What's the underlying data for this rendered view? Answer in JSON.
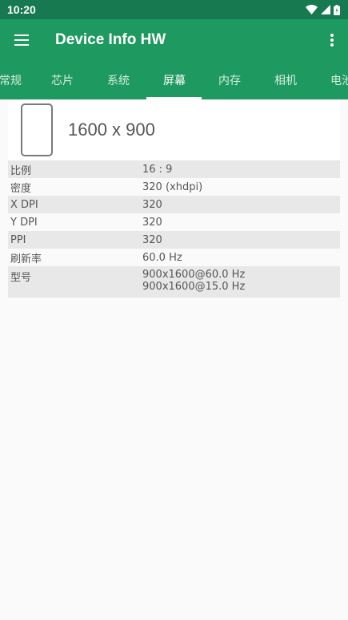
{
  "status_bar": {
    "time": "10:20",
    "icons": [
      "wifi-icon",
      "signal-icon",
      "battery-icon"
    ]
  },
  "app_bar": {
    "title": "Device Info HW",
    "menu_icon": "hamburger-menu-icon",
    "overflow_icon": "more-vert-icon"
  },
  "tabs": [
    {
      "label": "常规"
    },
    {
      "label": "芯片"
    },
    {
      "label": "系统"
    },
    {
      "label": "屏幕",
      "active": true
    },
    {
      "label": "内存"
    },
    {
      "label": "相机"
    },
    {
      "label": "电池"
    }
  ],
  "screen": {
    "resolution": "1600 x 900",
    "rows": [
      {
        "label": "比例",
        "value": "16 : 9"
      },
      {
        "label": "密度",
        "value": "320 (xhdpi)"
      },
      {
        "label": "X DPI",
        "value": "320"
      },
      {
        "label": "Y DPI",
        "value": "320"
      },
      {
        "label": "PPI",
        "value": "320"
      },
      {
        "label": "刷新率",
        "value": "60.0 Hz"
      },
      {
        "label": "型号",
        "values": [
          "900x1600@60.0 Hz",
          "900x1600@15.0 Hz"
        ]
      }
    ]
  },
  "colors": {
    "status_bar": "#16794f",
    "app_bar": "#1e9960",
    "row_shade": "#e8e8e8"
  }
}
